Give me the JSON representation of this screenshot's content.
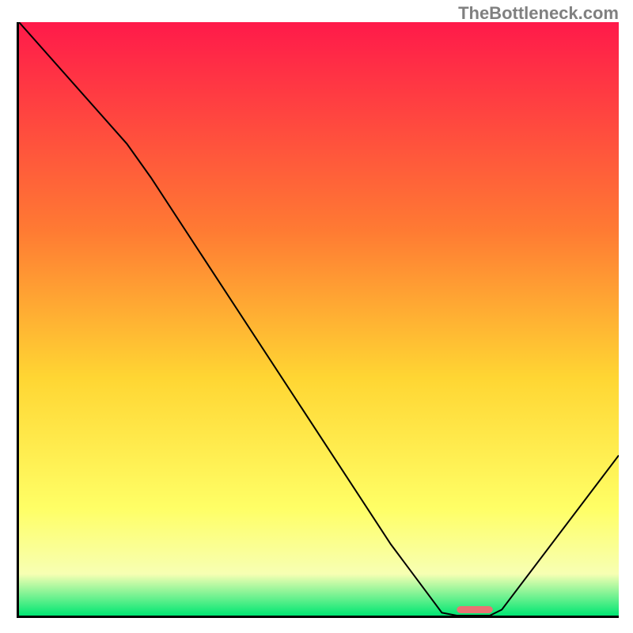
{
  "watermark": "TheBottleneck.com",
  "chart_data": {
    "type": "line",
    "title": "",
    "xlabel": "",
    "ylabel": "",
    "xlim": [
      0,
      100
    ],
    "ylim": [
      0,
      100
    ],
    "grid": false,
    "bg_gradient": {
      "top": "#ff1a4a",
      "mid1": "#ff7a33",
      "mid2": "#ffd633",
      "mid3": "#ffff66",
      "mid4": "#f7ffb3",
      "bottom": "#00e673"
    },
    "series": [
      {
        "name": "bottleneck-curve",
        "stroke": "#000000",
        "stroke_width": 2,
        "points": [
          {
            "x": 0.0,
            "y": 100.0
          },
          {
            "x": 18.0,
            "y": 79.5
          },
          {
            "x": 22.0,
            "y": 73.8
          },
          {
            "x": 62.0,
            "y": 12.0
          },
          {
            "x": 70.5,
            "y": 0.5
          },
          {
            "x": 73.0,
            "y": 0.0
          },
          {
            "x": 78.5,
            "y": 0.0
          },
          {
            "x": 80.5,
            "y": 1.0
          },
          {
            "x": 100.0,
            "y": 27.0
          }
        ]
      }
    ],
    "markers": [
      {
        "name": "target-marker",
        "shape": "rounded-rect",
        "fill": "#e97373",
        "x_start": 73.0,
        "x_end": 79.0,
        "y": 1.0,
        "height_pct": 1.2
      }
    ]
  }
}
